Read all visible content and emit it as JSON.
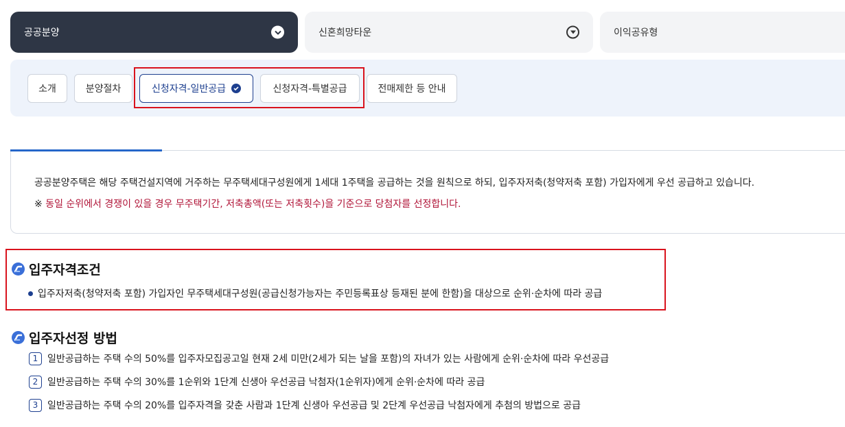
{
  "dropdowns": {
    "category": "공공분양",
    "subtype": "신혼희망타운",
    "type": "이익공유형"
  },
  "tabs": [
    {
      "label": "소개"
    },
    {
      "label": "분양절차"
    },
    {
      "label": "신청자격-일반공급",
      "active": true
    },
    {
      "label": "신청자격-특별공급"
    },
    {
      "label": "전매제한 등 안내"
    }
  ],
  "notice": {
    "text": "공공분양주택은 해당 주택건설지역에 거주하는 무주택세대구성원에게 1세대 1주택을 공급하는 것을 원칙으로 하되, 입주자저축(청약저축 포함) 가입자에게 우선 공급하고 있습니다.",
    "warn_mark": "※",
    "warn_text": "동일 순위에서 경쟁이 있을 경우 무주택기간, 저축총액(또는 저축횟수)을 기준으로 당첨자를 선정합니다."
  },
  "qualification": {
    "title": "입주자격조건",
    "bullet": "입주자저축(청약저축 포함) 가입자인 무주택세대구성원(공급신청가능자는 주민등록표상 등재된 분에 한함)을 대상으로 순위·순차에 따라 공급"
  },
  "selection": {
    "title": "입주자선정 방법",
    "items": [
      {
        "num": "1",
        "text": "일반공급하는 주택 수의 50%를 입주자모집공고일 현재 2세 미만(2세가 되는 날을 포함)의 자녀가 있는 사람에게 순위·순차에 따라 우선공급"
      },
      {
        "num": "2",
        "text": "일반공급하는 주택 수의 30%를 1순위와 1단계 신생아 우선공급 낙첨자(1순위자)에게 순위·순차에 따라 공급"
      },
      {
        "num": "3",
        "text": "일반공급하는 주택 수의 20%를 입주자격을 갖춘 사람과 1단계 신생아 우선공급 및 2단계 우선공급 낙첨자에게 추첨의 방법으로 공급"
      }
    ]
  },
  "colors": {
    "dark_dropdown": "#2e3645",
    "accent": "#1d3f8f",
    "warn": "#b01437",
    "highlight_box": "#d9121c"
  }
}
